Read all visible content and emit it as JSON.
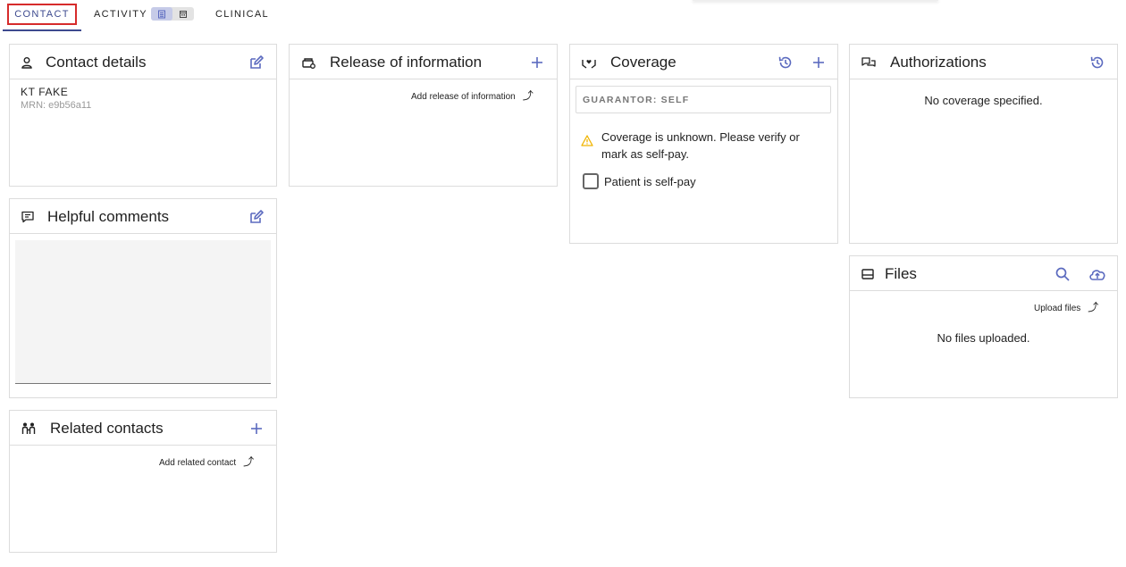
{
  "tabs": {
    "contact": "CONTACT",
    "activity": "ACTIVITY",
    "clinical": "CLINICAL"
  },
  "contact_details": {
    "title": "Contact details",
    "name": "KT FAKE",
    "mrn": "MRN: e9b56a11"
  },
  "release_of_information": {
    "title": "Release of information",
    "add_label": "Add release of information"
  },
  "coverage": {
    "title": "Coverage",
    "guarantor": "GUARANTOR: SELF",
    "warning": "Coverage is unknown. Please verify or mark as self-pay.",
    "self_pay_label": "Patient is self-pay"
  },
  "authorizations": {
    "title": "Authorizations",
    "empty": "No coverage specified."
  },
  "helpful_comments": {
    "title": "Helpful comments"
  },
  "files": {
    "title": "Files",
    "upload_label": "Upload files",
    "empty": "No files uploaded."
  },
  "related_contacts": {
    "title": "Related contacts",
    "add_label": "Add related contact"
  },
  "colors": {
    "accent": "#5b6abf",
    "tab_active": "#3d4a8f",
    "highlight_border": "#d62b2b",
    "warning": "#f0b400"
  }
}
